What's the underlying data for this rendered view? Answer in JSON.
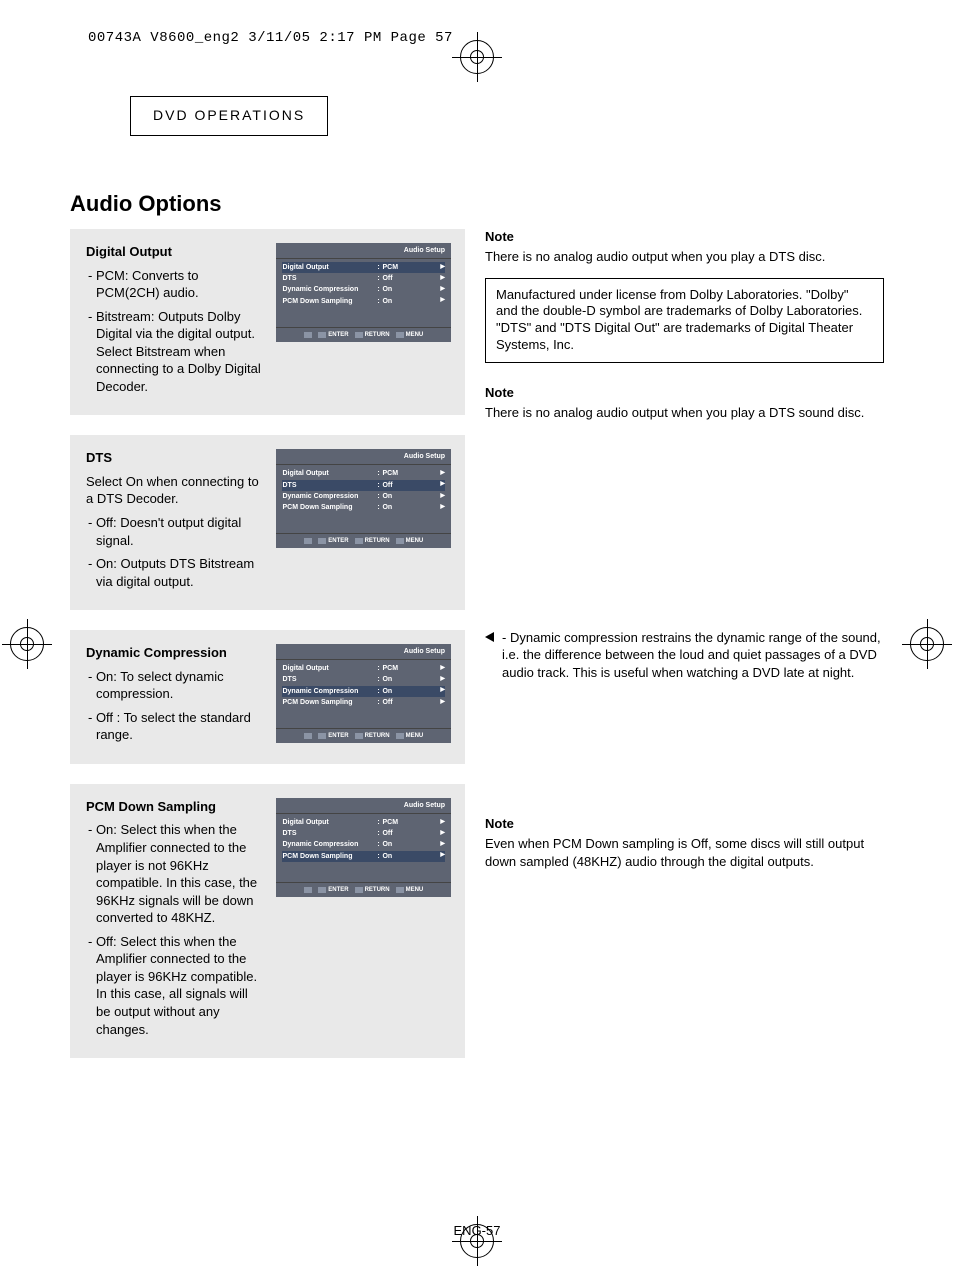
{
  "print_header": "00743A V8600_eng2  3/11/05  2:17 PM  Page 57",
  "section_tab": "DVD OPERATIONS",
  "main_heading": "Audio Options",
  "osd_title": "Audio Setup",
  "osd_footer": {
    "enter": "ENTER",
    "return": "RETURN",
    "menu": "MENU"
  },
  "blocks": {
    "digital_output": {
      "heading": "Digital Output",
      "b1": "- PCM: Converts to PCM(2CH) audio.",
      "b2": "- Bitstream: Outputs Dolby Digital via the digital output. Select Bitstream when connecting to a Dolby Digital Decoder.",
      "rows": [
        {
          "label": "Digital Output",
          "val": "PCM",
          "hl": true
        },
        {
          "label": "DTS",
          "val": "Off",
          "hl": false
        },
        {
          "label": "Dynamic Compression",
          "val": "On",
          "hl": false
        },
        {
          "label": "PCM Down Sampling",
          "val": "On",
          "hl": false
        }
      ]
    },
    "dts": {
      "heading": "DTS",
      "intro": "Select On when connecting to a DTS Decoder.",
      "b1": "- Off: Doesn't output digital signal.",
      "b2": "- On: Outputs DTS Bitstream via digital output.",
      "rows": [
        {
          "label": "Digital Output",
          "val": "PCM",
          "hl": false
        },
        {
          "label": "DTS",
          "val": "Off",
          "hl": true
        },
        {
          "label": "Dynamic Compression",
          "val": "On",
          "hl": false
        },
        {
          "label": "PCM Down Sampling",
          "val": "On",
          "hl": false
        }
      ]
    },
    "dc": {
      "heading": "Dynamic Compression",
      "b1": "- On: To select dynamic compression.",
      "b2": "- Off : To select the standard range.",
      "rows": [
        {
          "label": "Digital Output",
          "val": "PCM",
          "hl": false
        },
        {
          "label": "DTS",
          "val": "On",
          "hl": false
        },
        {
          "label": "Dynamic Compression",
          "val": "On",
          "hl": true
        },
        {
          "label": "PCM Down Sampling",
          "val": "Off",
          "hl": false
        }
      ]
    },
    "pcm": {
      "heading": "PCM Down Sampling",
      "b1": "- On: Select this when the Amplifier connected to the player is not 96KHz compatible. In this case, the 96KHz signals will be down converted to 48KHZ.",
      "b2": "- Off: Select this when the Amplifier connected to the player is 96KHz compatible. In this case, all signals will be output without any changes.",
      "rows": [
        {
          "label": "Digital Output",
          "val": "PCM",
          "hl": false
        },
        {
          "label": "DTS",
          "val": "Off",
          "hl": false
        },
        {
          "label": "Dynamic Compression",
          "val": "On",
          "hl": false
        },
        {
          "label": "PCM Down Sampling",
          "val": "On",
          "hl": true
        }
      ]
    }
  },
  "right": {
    "note_heading": "Note",
    "note1": "There is no analog audio output when you play a DTS disc.",
    "legal": "Manufactured under license from Dolby Laboratories. \"Dolby\" and the double-D symbol are trademarks of Dolby Laboratories.\n\"DTS\" and \"DTS Digital Out\" are trademarks of Digital Theater Systems, Inc.",
    "note2": "There is no analog audio output when you play a DTS sound disc.",
    "dc_note": "Dynamic compression restrains the dynamic range of the sound, i.e. the difference between the loud and quiet passages of a DVD audio track. This is useful when watching a DVD late at night.",
    "pcm_note": "Even when PCM Down sampling is Off, some discs will still output down sampled (48KHZ) audio through the digital outputs."
  },
  "page_num": "ENG-57"
}
